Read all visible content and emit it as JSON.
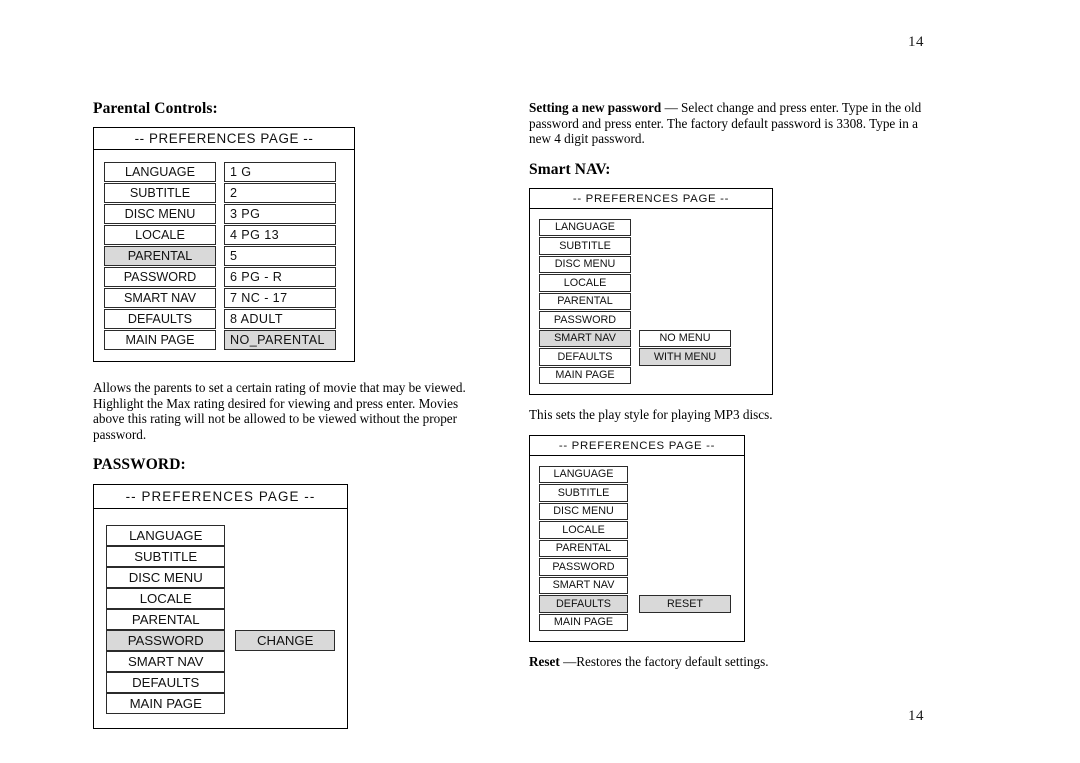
{
  "page": {
    "number_top": "14",
    "number_bottom": "14"
  },
  "left_column": {
    "parental_heading": "Parental Controls:",
    "parental_diagram": {
      "header": "--  PREFERENCES  PAGE  --",
      "menu_items": [
        "LANGUAGE",
        "SUBTITLE",
        "DISC MENU",
        "LOCALE",
        "PARENTAL",
        "PASSWORD",
        "SMART NAV",
        "DEFAULTS",
        "MAIN PAGE"
      ],
      "selected_menu_item": "PARENTAL",
      "values": [
        "1  G",
        "2",
        "3  PG",
        "4  PG  13",
        "5",
        "6  PG - R",
        "7  NC - 17",
        "8  ADULT",
        "NO_PARENTAL"
      ],
      "selected_value": "NO_PARENTAL"
    },
    "parental_description": "Allows the parents to set a certain rating of movie that may be viewed. Highlight the Max rating desired for viewing and press enter.  Movies above this rating will not be allowed to be viewed without the proper password.",
    "password_heading": "PASSWORD:",
    "password_diagram": {
      "header": "--  PREFERENCES  PAGE  --",
      "menu_items": [
        "LANGUAGE",
        "SUBTITLE",
        "DISC MENU",
        "LOCALE",
        "PARENTAL",
        "PASSWORD",
        "SMART NAV",
        "DEFAULTS",
        "MAIN PAGE"
      ],
      "selected_menu_item": "PASSWORD",
      "values": [
        "",
        "",
        "",
        "",
        "",
        "CHANGE",
        "",
        "",
        ""
      ],
      "selected_value": "CHANGE"
    }
  },
  "right_column": {
    "new_password_lead": "Setting a new password",
    "new_password_text": " — Select change and press enter.  Type in the old password and press enter.  The factory default password is 3308.  Type in a new 4 digit password.",
    "smart_nav_heading": "Smart NAV:",
    "smart_nav_diagram": {
      "header": "--  PREFERENCES  PAGE  --",
      "menu_items": [
        "LANGUAGE",
        "SUBTITLE",
        "DISC MENU",
        "LOCALE",
        "PARENTAL",
        "PASSWORD",
        "SMART NAV",
        "DEFAULTS",
        "MAIN PAGE"
      ],
      "selected_menu_item": "SMART NAV",
      "values": [
        "",
        "",
        "",
        "",
        "",
        "",
        "NO MENU",
        "WITH MENU",
        ""
      ],
      "selected_value": "WITH MENU"
    },
    "smart_nav_description": "This sets the play style for playing MP3 discs.",
    "defaults_diagram": {
      "header": "--  PREFERENCES  PAGE  --",
      "menu_items": [
        "LANGUAGE",
        "SUBTITLE",
        "DISC MENU",
        "LOCALE",
        "PARENTAL",
        "PASSWORD",
        "SMART NAV",
        "DEFAULTS",
        "MAIN PAGE"
      ],
      "selected_menu_item": "DEFAULTS",
      "values": [
        "",
        "",
        "",
        "",
        "",
        "",
        "",
        "RESET",
        ""
      ],
      "selected_value": "RESET"
    },
    "reset_lead": "Reset",
    "reset_text": " —Restores the factory default settings."
  }
}
